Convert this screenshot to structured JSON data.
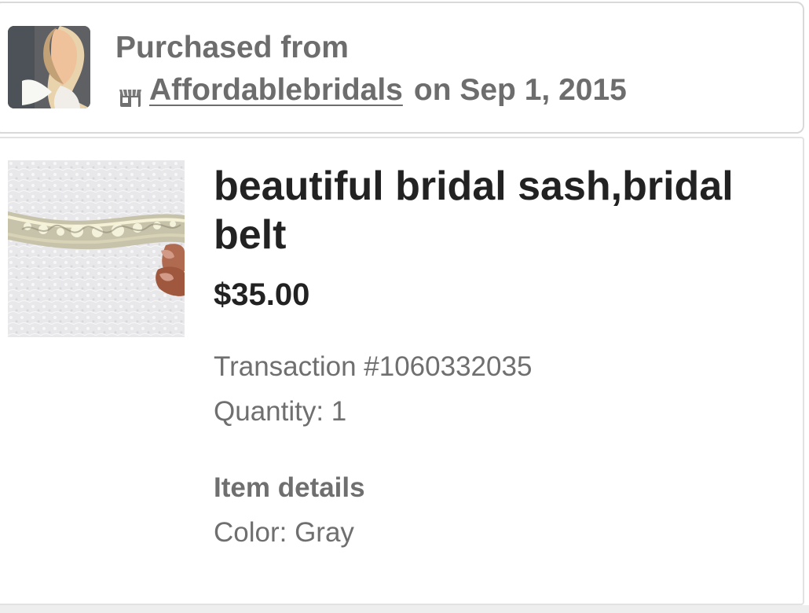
{
  "purchase": {
    "label": "Purchased from",
    "shop_icon": "shop-icon",
    "shop_name": "Affordablebridals",
    "date_text": "on Sep 1, 2015"
  },
  "item": {
    "title": "beautiful bridal sash,bridal belt",
    "price": "$35.00",
    "transaction": "Transaction #1060332035",
    "quantity": "Quantity: 1",
    "details_heading": "Item details",
    "color": "Color: Gray"
  },
  "colors": {
    "primary_text": "#222222",
    "secondary_text": "#6d6d6d",
    "border": "#d9d9d9"
  }
}
